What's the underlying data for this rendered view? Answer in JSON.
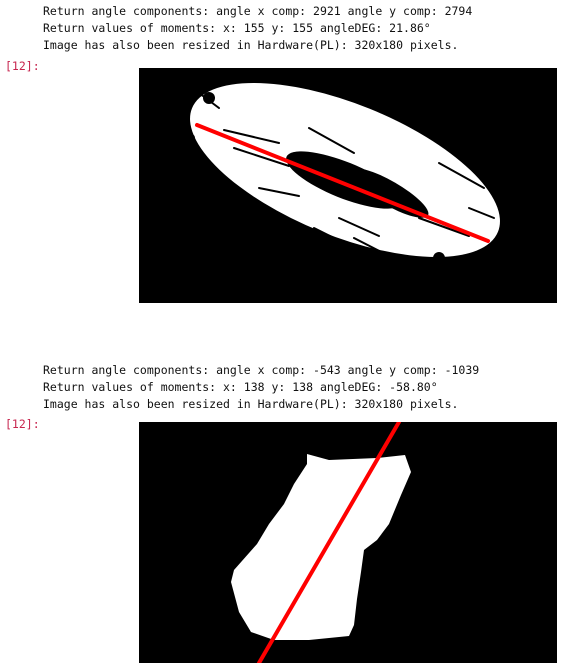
{
  "cells": [
    {
      "stdout_lines": [
        "Return angle components: angle x comp: 2921 angle y comp: 2794",
        "Return values of moments: x: 155 y: 155 angleDEG: 21.86°",
        "Image has also been resized in Hardware(PL): 320x180 pixels."
      ],
      "prompt": "[12]:",
      "image_description": "binary-mask-ring",
      "line_color": "#ff0000"
    },
    {
      "stdout_lines": [
        "Return angle components: angle x comp: -543 angle y comp: -1039",
        "Return values of moments: x: 138 y: 138 angleDEG: -58.80°",
        "Image has also been resized in Hardware(PL): 320x180 pixels."
      ],
      "prompt": "[12]:",
      "image_description": "binary-mask-blob",
      "line_color": "#ff0000"
    }
  ]
}
